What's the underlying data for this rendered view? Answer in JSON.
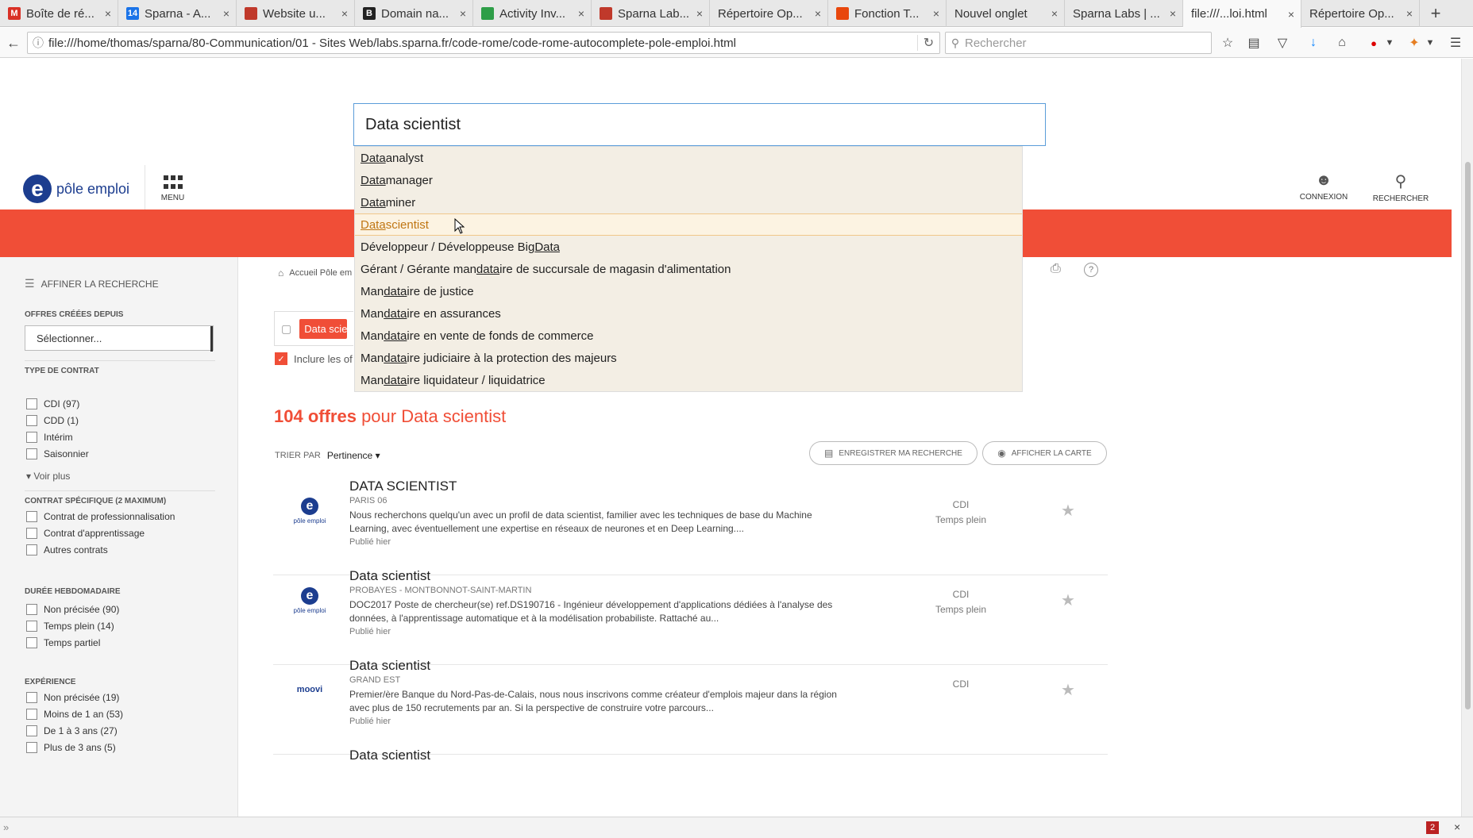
{
  "browser": {
    "tabs": [
      {
        "label": "Boîte de ré...",
        "favicon": "gmail-icon",
        "color": "#d93025",
        "glyph": "M",
        "active": false
      },
      {
        "label": "Sparna - A...",
        "favicon": "calendar-icon",
        "color": "#1a73e8",
        "glyph": "14",
        "active": false
      },
      {
        "label": "Website u...",
        "favicon": "image-icon",
        "color": "#c0392b",
        "glyph": "",
        "active": false
      },
      {
        "label": "Domain na...",
        "favicon": "domain-icon",
        "color": "#222222",
        "glyph": "B",
        "active": false
      },
      {
        "label": "Activity Inv...",
        "favicon": "activity-icon",
        "color": "#2e9e48",
        "glyph": "",
        "active": false
      },
      {
        "label": "Sparna Lab...",
        "favicon": "image-icon",
        "color": "#c0392b",
        "glyph": "",
        "active": false
      },
      {
        "label": "Répertoire Op...",
        "favicon": "",
        "color": "",
        "glyph": "",
        "active": false
      },
      {
        "label": "Fonction T...",
        "favicon": "office-icon",
        "color": "#e8470c",
        "glyph": "",
        "active": false
      },
      {
        "label": "Nouvel onglet",
        "favicon": "",
        "color": "",
        "glyph": "",
        "active": false
      },
      {
        "label": "Sparna Labs | ...",
        "favicon": "",
        "color": "",
        "glyph": "",
        "active": false
      },
      {
        "label": "file:///...loi.html",
        "favicon": "",
        "color": "",
        "glyph": "",
        "active": true
      },
      {
        "label": "Répertoire Op...",
        "favicon": "",
        "color": "",
        "glyph": "",
        "active": false
      }
    ],
    "new_tab": "+",
    "url": "file:///home/thomas/sparna/80-Communication/01 - Sites Web/labs.sparna.fr/code-rome/code-rome-autocomplete-pole-emploi.html",
    "search_placeholder": "Rechercher",
    "status_badge": "2"
  },
  "site": {
    "logo_text": "pôle emploi",
    "menu_label": "MENU",
    "connexion": "CONNEXION",
    "rechercher": "RECHERCHER",
    "brand_color": "#f04e37"
  },
  "sidebar": {
    "refine": "AFFINER LA RECHERCHE",
    "offres_title": "OFFRES CRÉÉES DEPUIS",
    "select_value": "Sélectionner...",
    "contrat_title": "TYPE DE CONTRAT",
    "contrat_items": [
      "CDI (97)",
      "CDD (1)",
      "Intérim",
      "Saisonnier"
    ],
    "voir_plus": "Voir plus",
    "specifique_title": "CONTRAT SPÉCIFIQUE (2 MAXIMUM)",
    "specifique_items": [
      "Contrat de professionnalisation",
      "Contrat d'apprentissage",
      "Autres contrats"
    ],
    "duree_title": "DURÉE HEBDOMADAIRE",
    "duree_items": [
      "Non précisée (90)",
      "Temps plein (14)",
      "Temps partiel"
    ],
    "experience_title": "EXPÉRIENCE",
    "experience_items": [
      "Non précisée (19)",
      "Moins de 1 an (53)",
      "De 1 à 3 ans (27)",
      "Plus de 3 ans (5)"
    ]
  },
  "main": {
    "breadcrumb": "Accueil Pôle em",
    "pill": "Data scien",
    "include_label": "Inclure les of",
    "results_count": "104 offres",
    "results_suffix": " pour Data scientist",
    "sort_label": "TRIER PAR",
    "sort_value": "Pertinence",
    "save_search": "ENREGISTRER MA RECHERCHE",
    "show_map": "AFFICHER LA CARTE"
  },
  "offers": [
    {
      "title": "DATA SCIENTIST",
      "location": "PARIS 06",
      "company": "",
      "desc": "Nous recherchons quelqu'un avec un profil de data scientist, familier avec les techniques de base du Machine Learning, avec éventuellement une expertise en réseaux de neurones et en Deep Learning....",
      "date": "Publié hier",
      "contract": "CDI",
      "time": "Temps plein",
      "logo": "pole-emploi"
    },
    {
      "title": "Data scientist",
      "location": "MONTBONNOT-SAINT-MARTIN",
      "company": "PROBAYES",
      "desc": "DOC2017 Poste de chercheur(se) ref.DS190716 - Ingénieur développement d'applications dédiées à l'analyse des données, à l'apprentissage automatique et à la modélisation probabiliste. Rattaché au...",
      "date": "Publié hier",
      "contract": "CDI",
      "time": "Temps plein",
      "logo": "pole-emploi"
    },
    {
      "title": "Data scientist",
      "location": "GRAND EST",
      "company": "",
      "desc": "Premier/ère Banque du Nord-Pas-de-Calais, nous nous inscrivons comme créateur d'emplois majeur dans la région avec plus de 150 recrutements par an. Si la perspective de construire votre parcours...",
      "date": "Publié hier",
      "contract": "CDI",
      "time": "",
      "logo": "moovijob"
    },
    {
      "title": "Data scientist",
      "location": "",
      "company": "",
      "desc": "",
      "date": "",
      "contract": "",
      "time": "",
      "logo": ""
    }
  ],
  "autocomplete": {
    "value": "Data scientist",
    "items": [
      {
        "pre": "",
        "match": "Data",
        "post": " analyst",
        "selected": false
      },
      {
        "pre": "",
        "match": "Data",
        "post": " manager",
        "selected": false
      },
      {
        "pre": "",
        "match": "Data",
        "post": " miner",
        "selected": false
      },
      {
        "pre": "",
        "match": "Data",
        "post": " scientist",
        "selected": true
      },
      {
        "pre": "Développeur / Développeuse Big ",
        "match": "Data",
        "post": "",
        "selected": false
      },
      {
        "pre": "Gérant / Gérante man",
        "match": "data",
        "post": "ire de succursale de magasin d'alimentation",
        "selected": false
      },
      {
        "pre": "Man",
        "match": "data",
        "post": "ire de justice",
        "selected": false
      },
      {
        "pre": "Man",
        "match": "data",
        "post": "ire en assurances",
        "selected": false
      },
      {
        "pre": "Man",
        "match": "data",
        "post": "ire en vente de fonds de commerce",
        "selected": false
      },
      {
        "pre": "Man",
        "match": "data",
        "post": "ire judiciaire à la protection des majeurs",
        "selected": false
      },
      {
        "pre": "Man",
        "match": "data",
        "post": "ire liquidateur / liquidatrice",
        "selected": false
      }
    ]
  }
}
